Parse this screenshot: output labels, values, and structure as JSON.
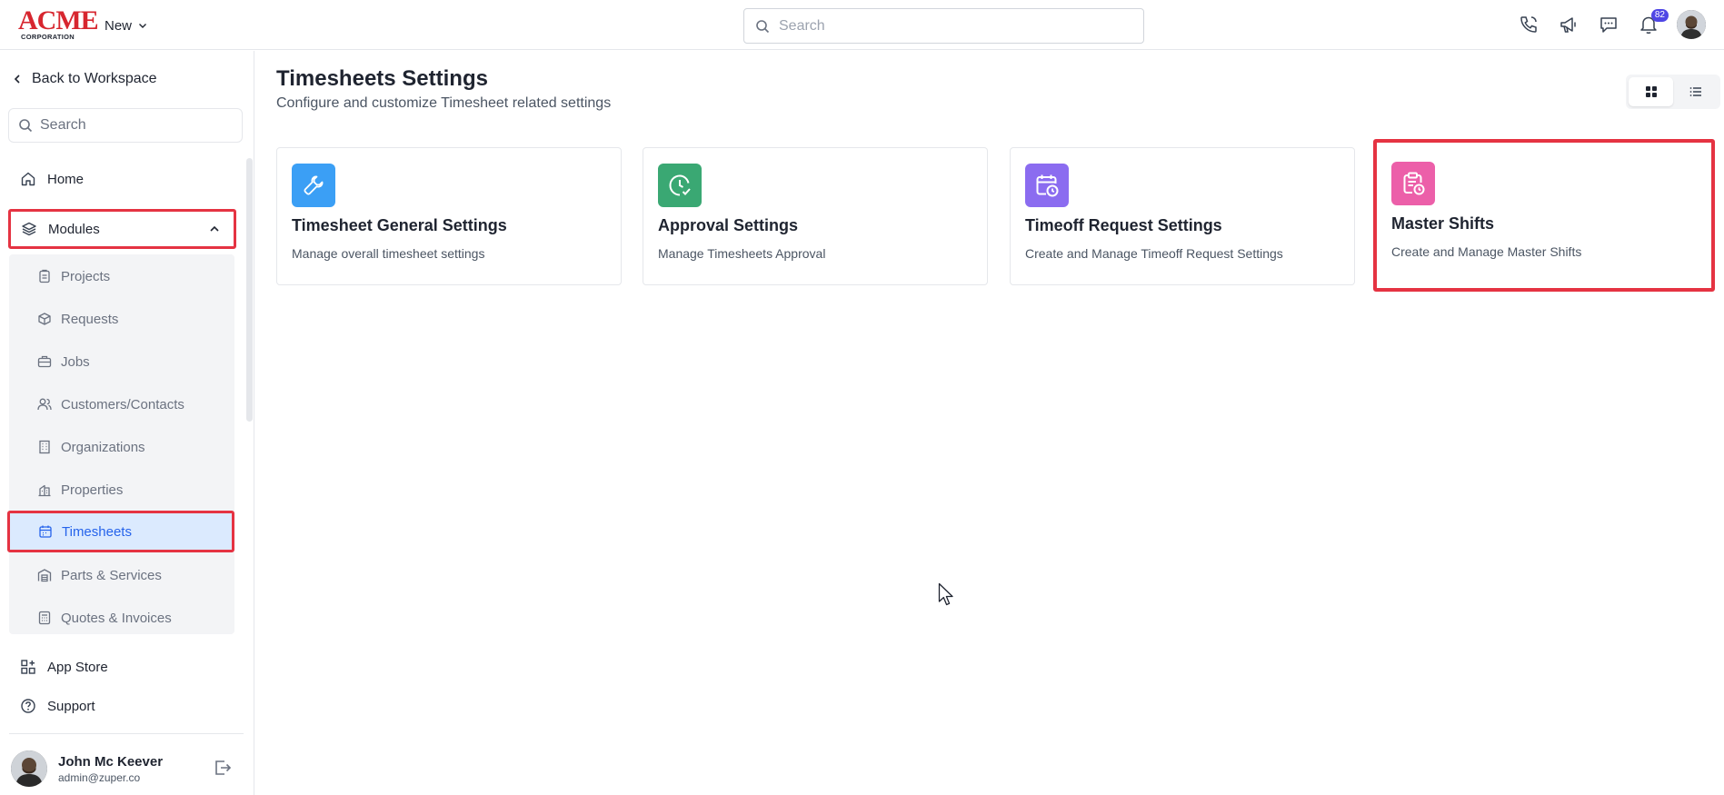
{
  "topbar": {
    "logo_big": "ACME",
    "logo_small": "CORPORATION",
    "new_label": "New",
    "search_placeholder": "Search",
    "notification_count": "82"
  },
  "sidebar": {
    "back_label": "Back to Workspace",
    "search_placeholder": "Search",
    "home_label": "Home",
    "modules_label": "Modules",
    "modules": [
      {
        "label": "Projects",
        "icon": "clipboard-icon"
      },
      {
        "label": "Requests",
        "icon": "box-icon"
      },
      {
        "label": "Jobs",
        "icon": "briefcase-icon"
      },
      {
        "label": "Customers/Contacts",
        "icon": "users-icon"
      },
      {
        "label": "Organizations",
        "icon": "building-icon"
      },
      {
        "label": "Properties",
        "icon": "property-icon"
      },
      {
        "label": "Timesheets",
        "icon": "calendar-icon",
        "active": true
      },
      {
        "label": "Parts & Services",
        "icon": "warehouse-icon"
      },
      {
        "label": "Quotes & Invoices",
        "icon": "invoice-icon"
      }
    ],
    "app_store_label": "App Store",
    "support_label": "Support",
    "user": {
      "name": "John Mc Keever",
      "email": "admin@zuper.co"
    }
  },
  "main": {
    "title": "Timesheets Settings",
    "subtitle": "Configure and customize Timesheet related settings",
    "cards": [
      {
        "title": "Timesheet General Settings",
        "desc": "Manage overall timesheet settings",
        "icon": "wrench-icon",
        "color": "#3b9ff5"
      },
      {
        "title": "Approval Settings",
        "desc": "Manage Timesheets Approval",
        "icon": "clock-check-icon",
        "color": "#3aa873"
      },
      {
        "title": "Timeoff Request Settings",
        "desc": "Create and Manage Timeoff Request Settings",
        "icon": "calendar-clock-icon",
        "color": "#8b6cf0"
      },
      {
        "title": "Master Shifts",
        "desc": "Create and Manage Master Shifts",
        "icon": "clipboard-clock-icon",
        "color": "#ec5fa9"
      }
    ]
  },
  "colors": {
    "highlight": "#e53342",
    "accent": "#2563eb",
    "active_bg": "#dbeafe"
  }
}
